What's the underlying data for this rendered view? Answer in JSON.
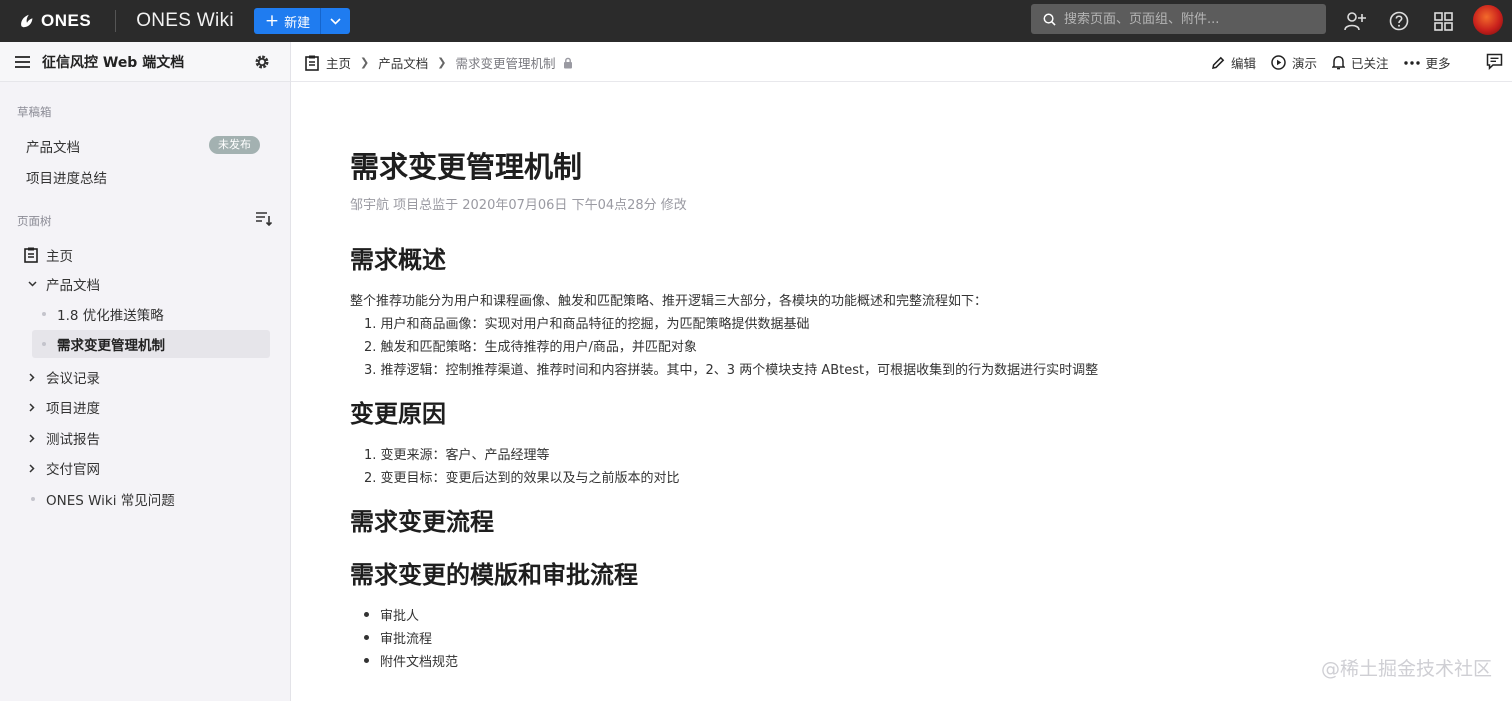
{
  "topbar": {
    "logo_text": "ONES",
    "app_title": "ONES Wiki",
    "new_button_label": "新建",
    "search_placeholder": "搜索页面、页面组、附件..."
  },
  "sidebar": {
    "title": "征信风控 Web 端文档",
    "drafts_section": "草稿箱",
    "drafts": [
      {
        "label": "产品文档",
        "badge": "未发布"
      },
      {
        "label": "项目进度总结"
      }
    ],
    "tree_section": "页面树",
    "tree": [
      {
        "label": "主页"
      },
      {
        "label": "产品文档"
      },
      {
        "label": "1.8 优化推送策略"
      },
      {
        "label": "需求变更管理机制"
      },
      {
        "label": "会议记录"
      },
      {
        "label": "项目进度"
      },
      {
        "label": "测试报告"
      },
      {
        "label": "交付官网"
      },
      {
        "label": "ONES Wiki 常见问题"
      }
    ]
  },
  "header": {
    "breadcrumb": [
      "主页",
      "产品文档",
      "需求变更管理机制"
    ],
    "actions": [
      "编辑",
      "演示",
      "已关注",
      "更多"
    ]
  },
  "document": {
    "title": "需求变更管理机制",
    "meta": "邹宇航 项目总监于 2020年07月06日 下午04点28分 修改",
    "sections": [
      {
        "heading": "需求概述",
        "intro": "整个推荐功能分为用户和课程画像、触发和匹配策略、推开逻辑三大部分，各模块的功能概述和完整流程如下：",
        "items": [
          "1. 用户和商品画像：实现对用户和商品特征的挖掘，为匹配策略提供数据基础",
          "2. 触发和匹配策略：生成待推荐的用户/商品，并匹配对象",
          "3. 推荐逻辑：控制推荐渠道、推荐时间和内容拼装。其中，2、3 两个模块支持 ABtest，可根据收集到的行为数据进行实时调整"
        ]
      },
      {
        "heading": "变更原因",
        "items": [
          "1. 变更来源：客户、产品经理等",
          "2. 变更目标：变更后达到的效果以及与之前版本的对比"
        ]
      },
      {
        "heading": "需求变更流程"
      },
      {
        "heading": "需求变更的模版和审批流程",
        "bullets": [
          "审批人",
          "审批流程",
          "附件文档规范"
        ]
      }
    ]
  },
  "watermark": "@稀土掘金技术社区",
  "colors": {
    "topbar": "#2b2b2b",
    "primary": "#1f7cf0",
    "sidebar": "#f4f3f7",
    "badge": "#a3b1b1"
  }
}
